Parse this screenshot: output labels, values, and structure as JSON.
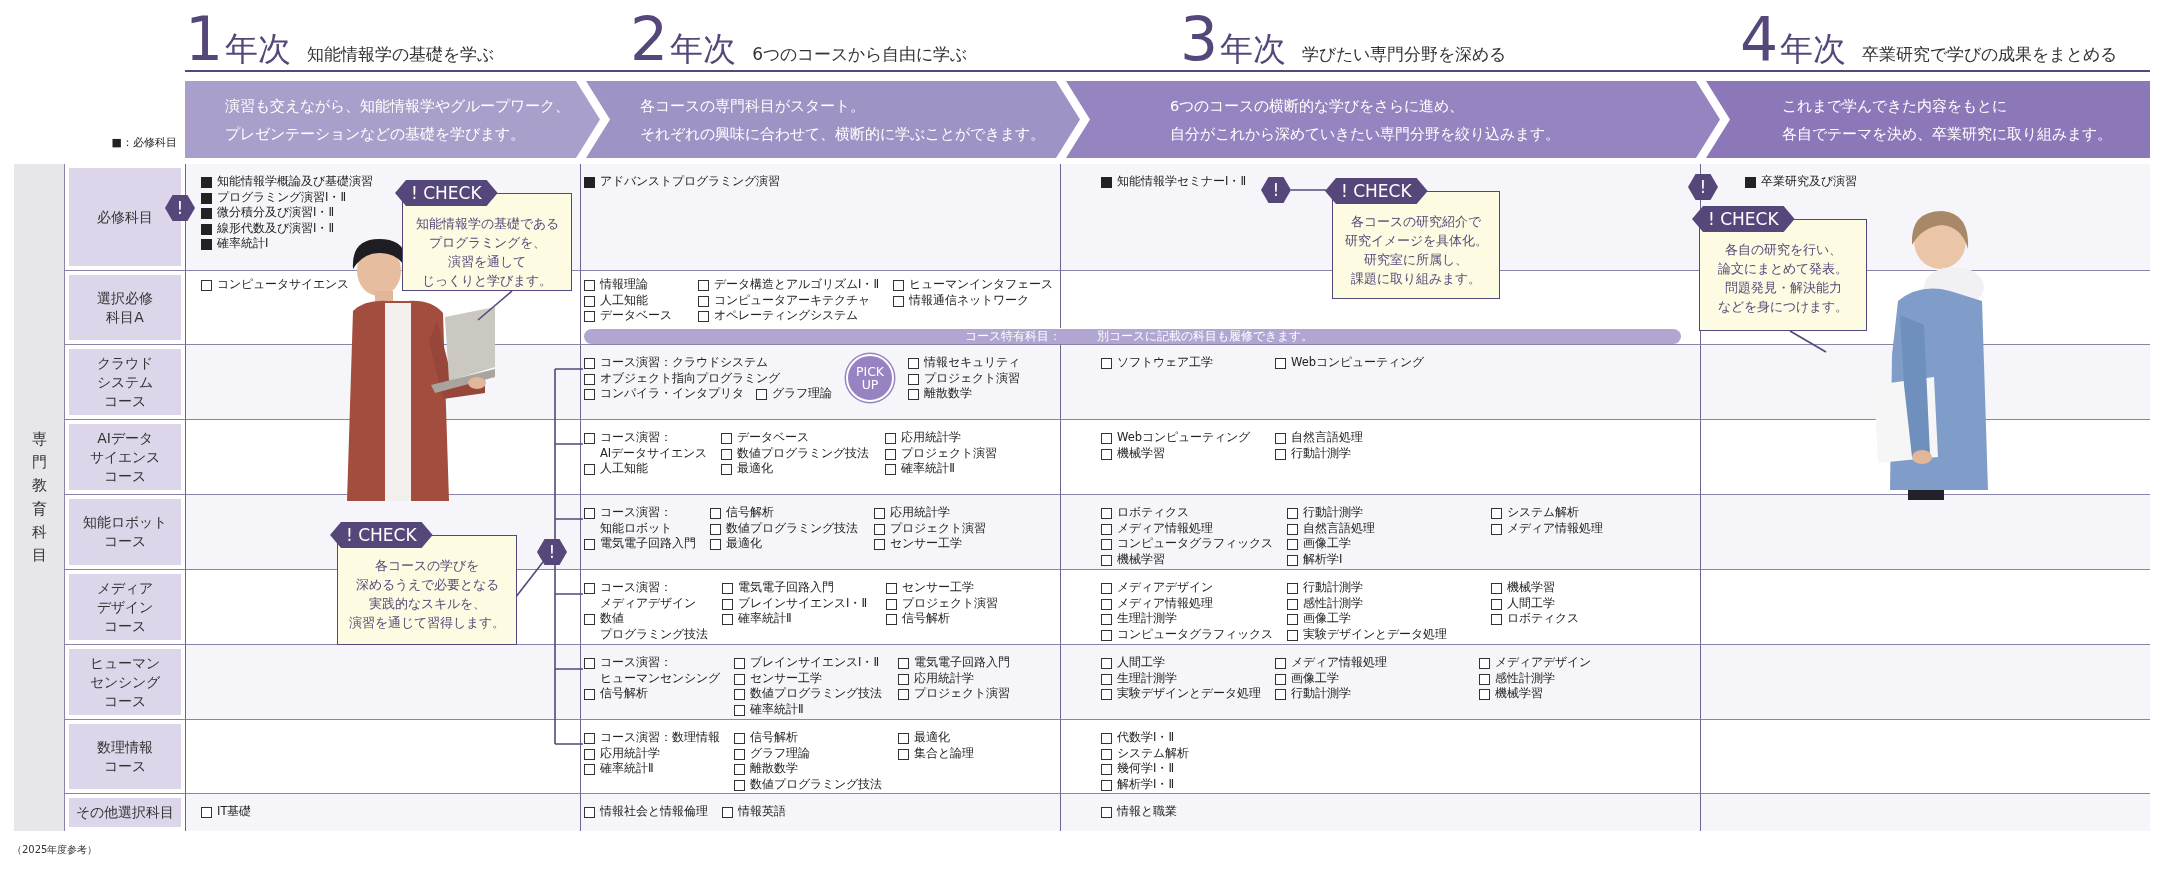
{
  "years": [
    {
      "number": "1",
      "unit": "年次",
      "theme": "知能情報学の基礎を学ぶ",
      "summary": [
        "演習も交えながら、知能情報学やグループワーク、",
        "プレゼンテーションなどの基礎を学びます。"
      ]
    },
    {
      "number": "2",
      "unit": "年次",
      "theme": "6つのコースから自由に学ぶ",
      "summary": [
        "各コースの専門科目がスタート。",
        "それぞれの興味に合わせて、横断的に学ぶことができます。"
      ]
    },
    {
      "number": "3",
      "unit": "年次",
      "theme": "学びたい専門分野を深める",
      "summary": [
        "6つのコースの横断的な学びをさらに進め、",
        "自分がこれから深めていきたい専門分野を絞り込みます。"
      ]
    },
    {
      "number": "4",
      "unit": "年次",
      "theme": "卒業研究で学びの成果をまとめる",
      "summary": [
        "これまで学んできた内容をもとに",
        "各自でテーマを決め、卒業研究に取り組みます。"
      ]
    }
  ],
  "legend": "■：必修科目",
  "side_label": "専門教育科目",
  "rows": [
    {
      "label": [
        "必修科目"
      ],
      "required": true,
      "year1": [
        [
          "知能情報学概論及び基礎演習",
          "プログラミング演習Ⅰ・Ⅱ",
          "微分積分及び演習Ⅰ・Ⅱ",
          "線形代数及び演習Ⅰ・Ⅱ",
          "確率統計Ⅰ"
        ]
      ],
      "year2": [
        [
          "アドバンストプログラミング演習"
        ]
      ],
      "year3": [
        [
          "知能情報学セミナーⅠ・Ⅱ"
        ]
      ],
      "year4": [
        [
          "卒業研究及び演習"
        ]
      ]
    },
    {
      "label": [
        "選択必修",
        "科目A"
      ],
      "required": false,
      "year1": [
        [
          "コンピュータサイエンス"
        ]
      ],
      "year2": [
        [
          "情報理論",
          "人工知能",
          "データベース"
        ],
        [
          "データ構造とアルゴリズムⅠ・Ⅱ",
          "コンピュータアーキテクチャ",
          "オペレーティングシステム"
        ],
        [
          "ヒューマンインタフェース",
          "情報通信ネットワーク"
        ]
      ]
    },
    {
      "label": [
        "クラウド",
        "システム",
        "コース"
      ],
      "required": false,
      "pickup": "PICK UP",
      "year2": [
        [
          "コース演習：クラウドシステム",
          "オブジェクト指向プログラミング",
          [
            "コンパイラ・インタプリタ",
            "グラフ理論"
          ]
        ],
        [
          "情報セキュリティ",
          "プロジェクト演習",
          "離散数学"
        ]
      ],
      "year3": [
        [
          "ソフトウェア工学"
        ],
        [
          "Webコンピューティング"
        ]
      ]
    },
    {
      "label": [
        "AIデータ",
        "サイエンス",
        "コース"
      ],
      "required": false,
      "year2": [
        [
          {
            "lines": [
              "コース演習：",
              "AIデータサイエンス"
            ]
          },
          "人工知能"
        ],
        [
          "データベース",
          "数値プログラミング技法",
          "最適化"
        ],
        [
          "応用統計学",
          "プロジェクト演習",
          "確率統計Ⅱ"
        ]
      ],
      "year3": [
        [
          "Webコンピューティング",
          "機械学習"
        ],
        [
          "自然言語処理",
          "行動計測学"
        ]
      ]
    },
    {
      "label": [
        "知能ロボット",
        "コース"
      ],
      "required": false,
      "year2": [
        [
          {
            "lines": [
              "コース演習：",
              "知能ロボット"
            ]
          },
          "電気電子回路入門"
        ],
        [
          "信号解析",
          "数値プログラミング技法",
          "最適化"
        ],
        [
          "応用統計学",
          "プロジェクト演習",
          "センサー工学"
        ]
      ],
      "year3": [
        [
          "ロボティクス",
          "メディア情報処理",
          "コンピュータグラフィックス",
          "機械学習"
        ],
        [
          "行動計測学",
          "自然言語処理",
          "画像工学",
          "解析学Ⅰ"
        ],
        [
          "システム解析",
          "メディア情報処理"
        ]
      ]
    },
    {
      "label": [
        "メディア",
        "デザイン",
        "コース"
      ],
      "required": false,
      "year2": [
        [
          {
            "lines": [
              "コース演習：",
              "メディアデザイン"
            ]
          },
          {
            "lines": [
              "数値",
              "プログラミング技法"
            ]
          }
        ],
        [
          "電気電子回路入門",
          "ブレインサイエンスⅠ・Ⅱ",
          "確率統計Ⅱ"
        ],
        [
          "センサー工学",
          "プロジェクト演習",
          "信号解析"
        ]
      ],
      "year3": [
        [
          "メディアデザイン",
          "メディア情報処理",
          "生理計測学",
          "コンピュータグラフィックス"
        ],
        [
          "行動計測学",
          "感性計測学",
          "画像工学",
          "実験デザインとデータ処理"
        ],
        [
          "機械学習",
          "人間工学",
          "ロボティクス"
        ]
      ]
    },
    {
      "label": [
        "ヒューマン",
        "センシング",
        "コース"
      ],
      "required": false,
      "year2": [
        [
          {
            "lines": [
              "コース演習：",
              "ヒューマンセンシング"
            ]
          },
          "信号解析"
        ],
        [
          "ブレインサイエンスⅠ・Ⅱ",
          "センサー工学",
          "数値プログラミング技法",
          "確率統計Ⅱ"
        ],
        [
          "電気電子回路入門",
          "応用統計学",
          "プロジェクト演習"
        ]
      ],
      "year3": [
        [
          "人間工学",
          "生理計測学",
          "実験デザインとデータ処理"
        ],
        [
          "メディア情報処理",
          "画像工学",
          "行動計測学"
        ],
        [
          "メディアデザイン",
          "感性計測学",
          "機械学習"
        ]
      ]
    },
    {
      "label": [
        "数理情報",
        "コース"
      ],
      "required": false,
      "year2": [
        [
          "コース演習：数理情報",
          "応用統計学",
          "確率統計Ⅱ"
        ],
        [
          "信号解析",
          "グラフ理論",
          "離散数学",
          "数値プログラミング技法"
        ],
        [
          "最適化",
          "集合と論理"
        ]
      ],
      "year3": [
        [
          "代数学Ⅰ・Ⅱ",
          "システム解析",
          "幾何学Ⅰ・Ⅱ",
          "解析学Ⅰ・Ⅱ"
        ]
      ]
    },
    {
      "label": [
        "その他選択科目"
      ],
      "required": false,
      "year1": [
        [
          "IT基礎"
        ]
      ],
      "year2": [
        [
          "情報社会と情報倫理"
        ],
        [
          "情報英語"
        ]
      ],
      "year3": [
        [
          "情報と職業"
        ]
      ]
    }
  ],
  "shared_note": {
    "label": "コース特有科目：",
    "text": "別コースに記載の科目も履修できます。"
  },
  "markers": [
    "!",
    "!",
    "!",
    "!"
  ],
  "callouts": [
    {
      "tag": "! CHECK",
      "text": [
        "知能情報学の基礎である",
        "プログラミングを、",
        "演習を通して",
        "じっくりと学びます。"
      ]
    },
    {
      "tag": "! CHECK",
      "text": [
        "各コースの研究紹介で",
        "研究イメージを具体化。",
        "研究室に所属し、",
        "課題に取り組みます。"
      ]
    },
    {
      "tag": "! CHECK",
      "text": [
        "各自の研究を行い、",
        "論文にまとめて発表。",
        "問題発見・解決能力",
        "などを身につけます。"
      ]
    },
    {
      "tag": "! CHECK",
      "text": [
        "各コースの学びを",
        "深めるうえで必要となる",
        "実践的なスキルを、",
        "演習を通じて習得します。"
      ]
    }
  ],
  "footnote": "（2025年度参考）"
}
